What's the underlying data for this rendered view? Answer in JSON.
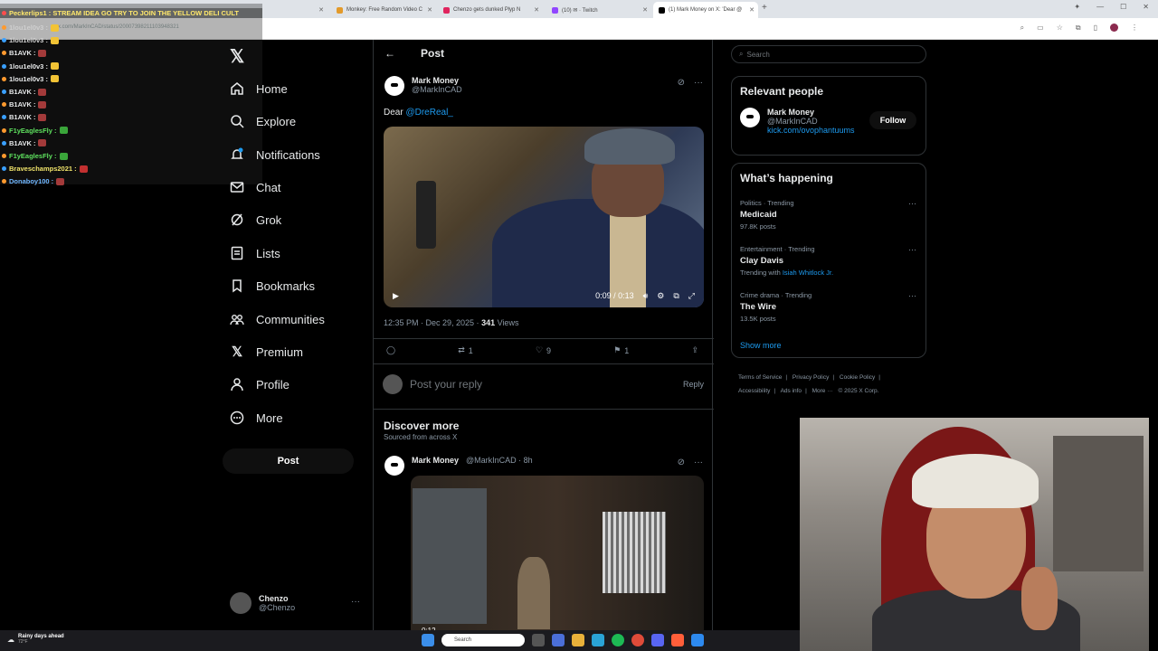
{
  "browser": {
    "tabs": [
      {
        "label": "",
        "active": false,
        "color": "#6b6b6b"
      },
      {
        "label": "Monkey: Free Random Video C",
        "active": false,
        "color": "#e39a2a"
      },
      {
        "label": "Chenzo gets dunked Plyp N",
        "active": false,
        "color": "#e0245e"
      },
      {
        "label": "(10) ✉ · Twitch",
        "active": false,
        "color": "#9146ff"
      },
      {
        "label": "(1) Mark Money on X: 'Dear @",
        "active": true,
        "color": "#000000"
      }
    ],
    "new_tab": "+",
    "url": "x.com/MarkInCAD/status/20007398211103948321"
  },
  "chat": {
    "banner": "Peckerlips1 : STREAM IDEA GO TRY TO JOIN THE YELLOW DELI CULT",
    "messages": [
      {
        "user": "1lou1el0v3 :",
        "color": "#cfcfcf",
        "emote": "#f2c335"
      },
      {
        "user": "1lou1el0v3 :",
        "color": "#cfcfcf",
        "emote": "#f2c335"
      },
      {
        "user": "B1AVK :",
        "color": "#e7e9ea",
        "emote": "#a33a3a"
      },
      {
        "user": "1lou1el0v3 :",
        "color": "#e7e9ea",
        "emote": "#f2c335"
      },
      {
        "user": "1lou1el0v3 :",
        "color": "#e7e9ea",
        "emote": "#f2c335"
      },
      {
        "user": "B1AVK :",
        "color": "#e7e9ea",
        "emote": "#a33a3a"
      },
      {
        "user": "B1AVK :",
        "color": "#e7e9ea",
        "emote": "#a33a3a"
      },
      {
        "user": "B1AVK :",
        "color": "#e7e9ea",
        "emote": "#a33a3a"
      },
      {
        "user": "F1yEaglesFly :",
        "color": "#5ee05e",
        "emote": "#3aa53a"
      },
      {
        "user": "B1AVK :",
        "color": "#e7e9ea",
        "emote": "#a33a3a"
      },
      {
        "user": "F1yEaglesFly :",
        "color": "#5ee05e",
        "emote": "#3aa53a"
      },
      {
        "user": "Braveschamps2021 :",
        "color": "#f0e36a",
        "emote": "#c23030"
      },
      {
        "user": "Donaboy100 :",
        "color": "#6fb6ff",
        "emote": "#a33a3a"
      }
    ]
  },
  "nav": {
    "items": [
      {
        "label": "Home",
        "icon": "home-icon"
      },
      {
        "label": "Explore",
        "icon": "search-icon"
      },
      {
        "label": "Notifications",
        "icon": "bell-icon"
      },
      {
        "label": "Chat",
        "icon": "mail-icon"
      },
      {
        "label": "Grok",
        "icon": "grok-icon"
      },
      {
        "label": "Lists",
        "icon": "list-icon"
      },
      {
        "label": "Bookmarks",
        "icon": "bookmark-icon"
      },
      {
        "label": "Communities",
        "icon": "communities-icon"
      },
      {
        "label": "Premium",
        "icon": "x-icon"
      },
      {
        "label": "Profile",
        "icon": "person-icon"
      },
      {
        "label": "More",
        "icon": "more-circle-icon"
      }
    ],
    "post_button": "Post",
    "profile": {
      "name": "Chenzo",
      "handle": "@Chenzo",
      "more": "···"
    }
  },
  "main": {
    "header_title": "Post",
    "back": "←",
    "post": {
      "author_name": "Mark Money",
      "author_handle": "@MarkInCAD",
      "text_prefix": "Dear ",
      "mention": "@DreReal_",
      "video_time": "0:09 / 0:13",
      "timestamp": "12:35 PM · Dec 29, 2025 · ",
      "views_count": "341",
      "views_label": " Views",
      "retweets": "1",
      "likes": "9",
      "bookmarks": "1"
    },
    "reply": {
      "placeholder": "Post your reply",
      "button": "Reply"
    },
    "discover": {
      "title": "Discover more",
      "subtitle": "Sourced from across X",
      "author_name": "Mark Money",
      "author_meta": "@MarkInCAD · 8h",
      "video_time": "0:12"
    }
  },
  "sidebar": {
    "search_placeholder": "Search",
    "relevant": {
      "title": "Relevant people",
      "name": "Mark Money",
      "handle": "@MarkInCAD",
      "link": "kick.com/ovophantuums",
      "follow": "Follow"
    },
    "happening": {
      "title": "What’s happening",
      "trends": [
        {
          "category": "Politics · Trending",
          "name": "Medicaid",
          "count": "97.8K posts",
          "link": ""
        },
        {
          "category": "Entertainment · Trending",
          "name": "Clay Davis",
          "count": "Trending with ",
          "link": "Isiah Whitlock Jr."
        },
        {
          "category": "Crime drama · Trending",
          "name": "The Wire",
          "count": "13.5K posts",
          "link": ""
        }
      ],
      "show_more": "Show more"
    },
    "footer": [
      "Terms of Service",
      "|",
      "Privacy Policy",
      "|",
      "Cookie Policy",
      "|",
      "Accessibility",
      "|",
      "Ads info",
      "|",
      "More ···",
      "© 2025 X Corp."
    ]
  },
  "taskbar": {
    "weather_title": "Rainy days ahead",
    "weather_temp": "72°F",
    "search": "Search"
  }
}
